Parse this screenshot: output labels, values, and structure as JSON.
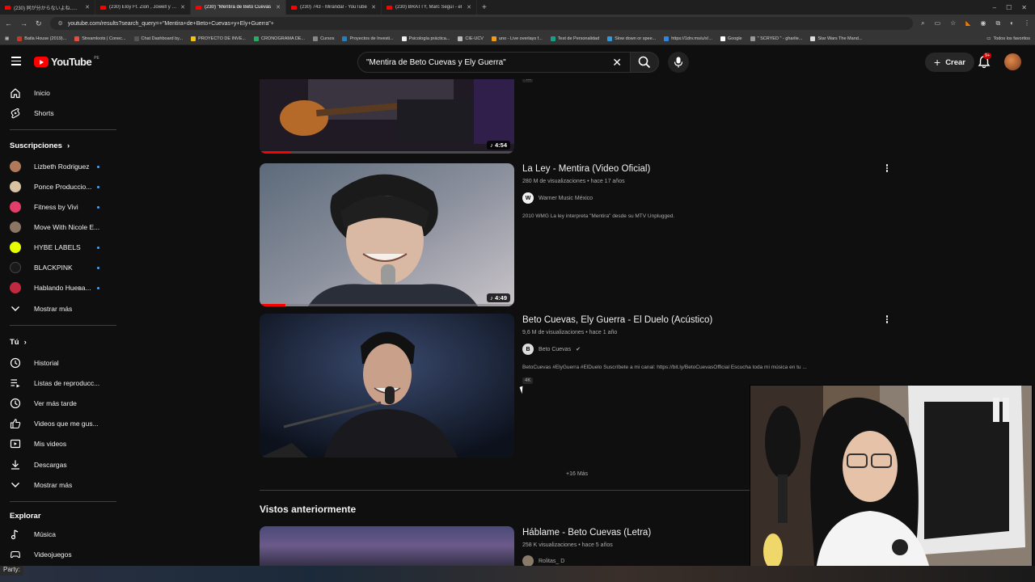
{
  "browser": {
    "tabs": [
      {
        "label": "(230) 同が分からないよね..この"
      },
      {
        "label": "(230) Eloy Ft. Zion , Jowell y Ra"
      },
      {
        "label": "(230) \"Mentira de Beto Cuevas"
      },
      {
        "label": "(230) 743 - Mirandal - YouTube"
      },
      {
        "label": "(230) BRATTY, Marc Seguí - el"
      }
    ],
    "url": "youtube.com/results?search_query=+\"Mentira+de+Beto+Cuevas+y+Ely+Guerra\"+",
    "bookmarks": [
      "Batla House (2019)...",
      "Streamloots | Conec...",
      "Chat Dashboard by...",
      "PROYECTO DE INVE...",
      "CRONOGRAMA DE...",
      "Cursos",
      "Proyectos de Investi...",
      "Psicología práctica...",
      "CIE-UCV",
      "uno - Live overlays f...",
      "Test de Personalidad",
      "Slow down or spee...",
      "https://1drv.ms/u/s!...",
      "Google",
      "\" SCRYED \" - gharlie...",
      "Star Wars The Mand..."
    ],
    "bookmarks_right": "Todos los favoritos",
    "status_text": "Party:"
  },
  "header": {
    "logo_text": "YouTube",
    "logo_country": "PE",
    "search_value": "\"Mentira de Beto Cuevas y Ely Guerra\"",
    "create_label": "Crear",
    "notif_badge": "9+"
  },
  "sidebar": {
    "main": [
      {
        "label": "Inicio",
        "icon": "home-icon"
      },
      {
        "label": "Shorts",
        "icon": "shorts-icon"
      }
    ],
    "subs_heading": "Suscripciones",
    "subs": [
      {
        "label": "Lizbeth Rodriguez",
        "color": "#b07a5a"
      },
      {
        "label": "Ponce Produccio...",
        "color": "#d9c3a3"
      },
      {
        "label": "Fitness by Vivi",
        "color": "#e33e6a"
      },
      {
        "label": "Move With Nicole E...",
        "color": "#8b7664"
      },
      {
        "label": "HYBE LABELS",
        "color": "#e6ff00"
      },
      {
        "label": "BLACKPINK",
        "color": "#1a1a1a"
      },
      {
        "label": "Hablando Huева...",
        "color": "#c02a40"
      }
    ],
    "subs_more": "Mostrar más",
    "you_heading": "Tú",
    "you": [
      {
        "label": "Historial",
        "icon": "history-icon"
      },
      {
        "label": "Listas de reproducc...",
        "icon": "playlist-icon"
      },
      {
        "label": "Ver más tarde",
        "icon": "watch-later-icon"
      },
      {
        "label": "Videos que me gus...",
        "icon": "like-icon"
      },
      {
        "label": "Mis videos",
        "icon": "my-videos-icon"
      },
      {
        "label": "Descargas",
        "icon": "download-icon"
      }
    ],
    "you_more": "Mostrar más",
    "explore_heading": "Explorar",
    "explore": [
      {
        "label": "Música",
        "icon": "music-icon"
      },
      {
        "label": "Videojuegos",
        "icon": "gaming-icon"
      }
    ]
  },
  "results": {
    "top_partial": {
      "badge": "4K",
      "duration": "4:54",
      "progress": 0.12
    },
    "videos": [
      {
        "title": "La Ley - Mentira (Video Oficial)",
        "meta": "280 M de visualizaciones • hace 17 años",
        "channel": "Warner Music México",
        "channel_initial": "W",
        "desc": "2010 WMG La ley interpreta \"Mentira\" desde su MTV Unplugged.",
        "duration": "4:49",
        "progress": 0.1
      },
      {
        "title": "Beto Cuevas, Ely Guerra - El Duelo (Acústico)",
        "meta": "9,6 M de visualizaciones • hace 1 año",
        "channel": "Beto Cuevas",
        "channel_initial": "B",
        "desc": "BetoCuevas #ElyGuerra #ElDuelo Suscríbete a mi canal: https://bit.ly/BetoCuevasOfficial Escucha toda mi música en tu ...",
        "badge": "4K"
      }
    ],
    "more_label": "+16 Más",
    "section_title": "Vistos anteriormente",
    "watched": {
      "title": "Háblame - Beto Cuevas (Letra)",
      "meta": "258 K visualizaciones • hace 5 años",
      "channel": "Rolitas_ D"
    }
  },
  "colors": {
    "accent": "#ff0000",
    "background": "#0f0f0f",
    "verified": "#aaaaaa"
  }
}
